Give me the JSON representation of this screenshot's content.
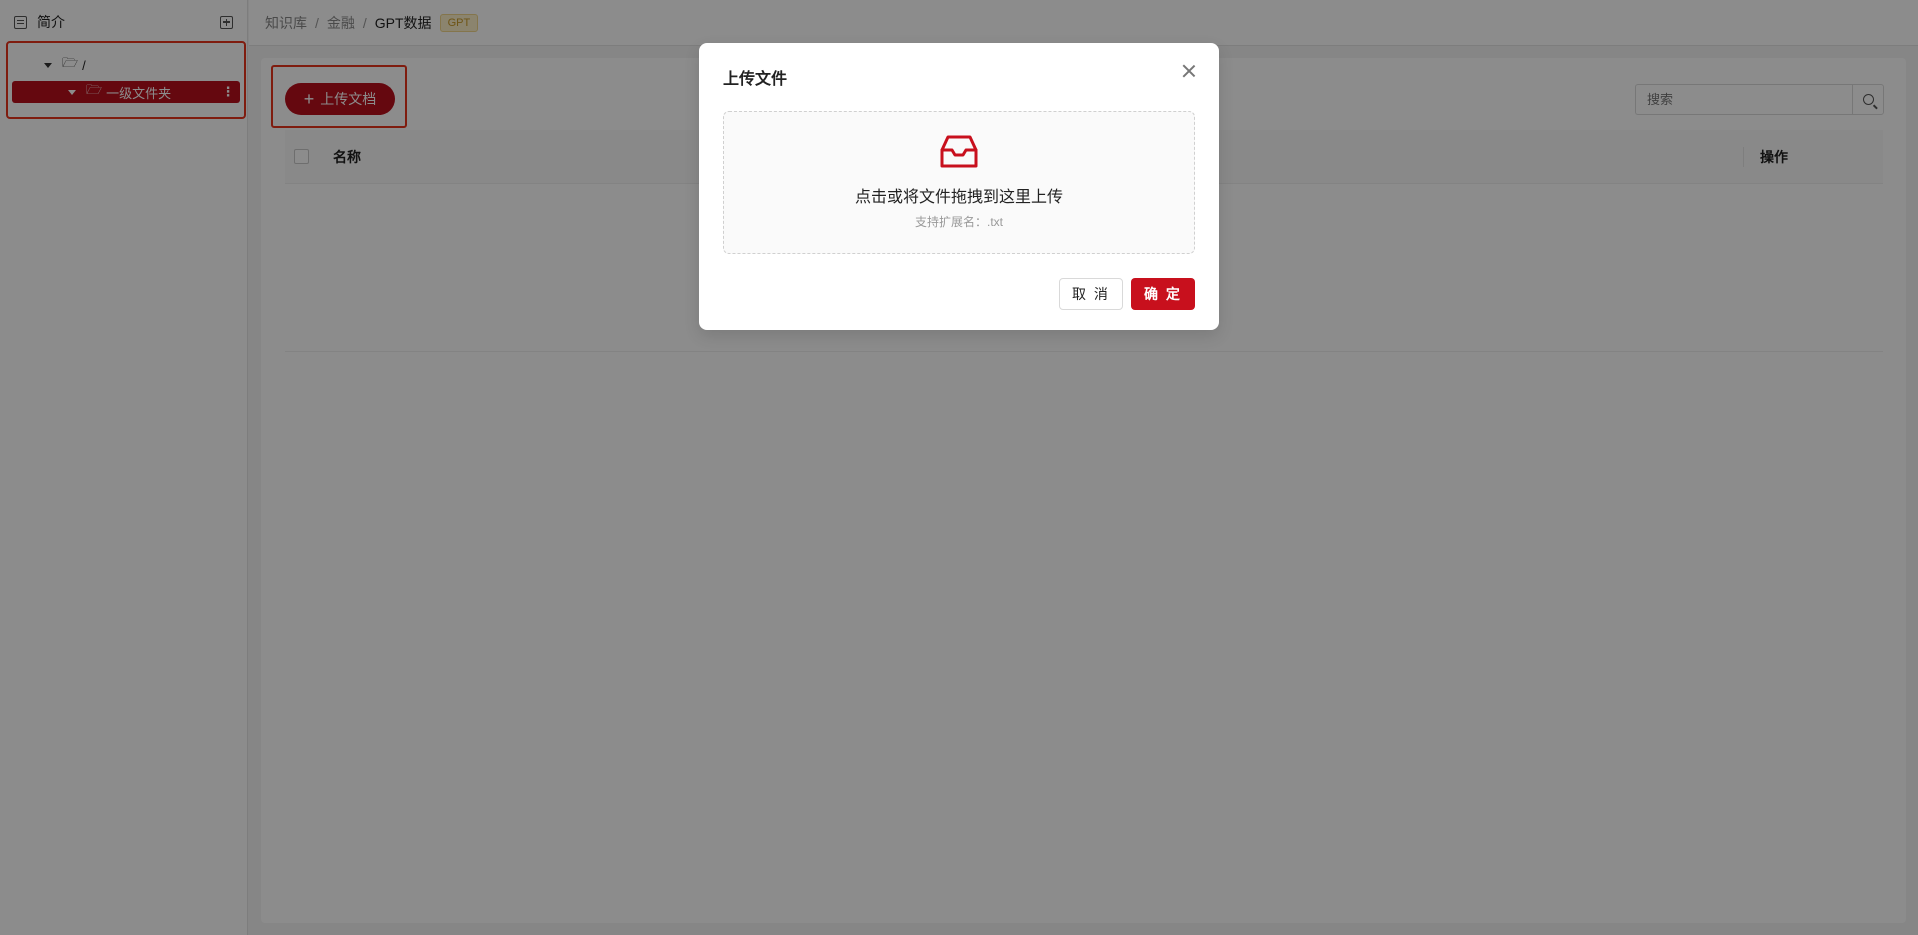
{
  "sidebar": {
    "title": "简介",
    "header_icon": "document-icon",
    "add_icon": "add-square-icon",
    "tree": {
      "root_label": "/",
      "child_label": "一级文件夹"
    }
  },
  "breadcrumb": {
    "items": [
      "知识库",
      "金融",
      "GPT数据"
    ],
    "separator": "/",
    "tag": "GPT"
  },
  "toolbar": {
    "upload_label": "上传文档",
    "search_placeholder": "搜索"
  },
  "table": {
    "columns": [
      "名称",
      "操作"
    ]
  },
  "modal": {
    "title": "上传文件",
    "drop_text": "点击或将文件拖拽到这里上传",
    "drop_hint": "支持扩展名：.txt",
    "cancel_label": "取 消",
    "ok_label": "确 定"
  },
  "colors": {
    "accent": "#c8101d",
    "highlight_border": "#e8341c",
    "tag_bg": "#fdf0c8"
  }
}
